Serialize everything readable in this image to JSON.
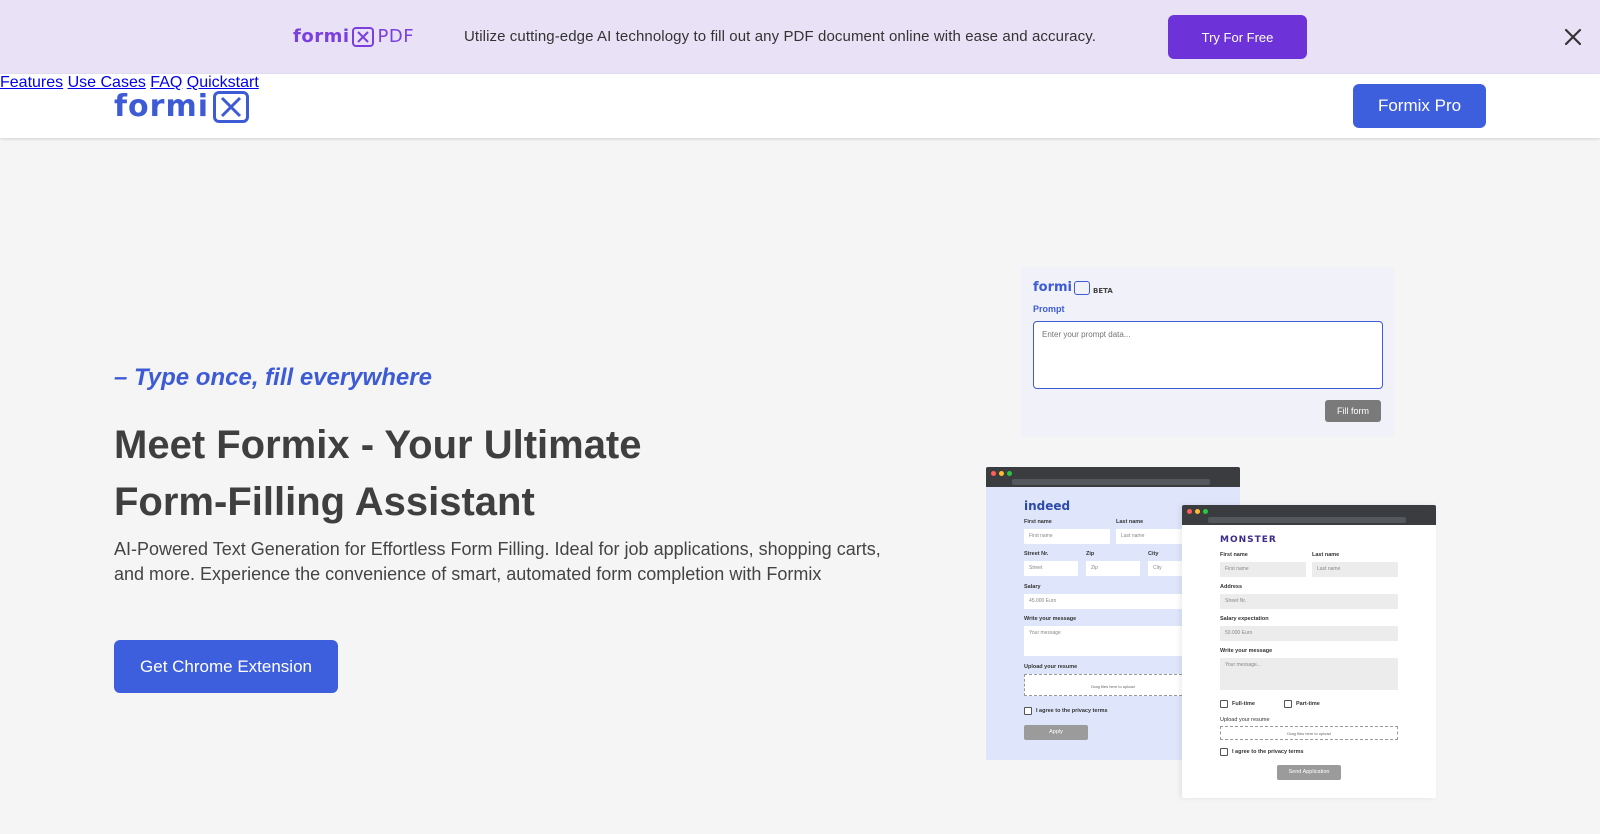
{
  "promo": {
    "logo_text": "formi",
    "logo_suffix": "PDF",
    "message": "Utilize cutting-edge AI technology to fill out any PDF document online with ease and accuracy.",
    "cta_label": "Try For Free"
  },
  "header": {
    "logo_text": "formi",
    "nav": [
      {
        "label": "Features"
      },
      {
        "label": "Use Cases"
      },
      {
        "label": "FAQ"
      },
      {
        "label": "Quickstart"
      }
    ],
    "pro_label": "Formix Pro"
  },
  "hero": {
    "tagline": "– Type once, fill everywhere",
    "headline_line1": "Meet Formix - Your Ultimate",
    "headline_line2": "Form-Filling Assistant",
    "subtitle": "AI-Powered Text Generation for Effortless Form Filling. Ideal for job applications, shopping carts, and more. Experience the convenience of smart, automated form completion with Formix",
    "cta_label": "Get Chrome Extension"
  },
  "extension": {
    "logo_text": "formi",
    "beta": "BETA",
    "prompt_label": "Prompt",
    "prompt_placeholder": "Enter your prompt data...",
    "fill_label": "Fill form"
  },
  "indeed_form": {
    "logo": "indeed",
    "first_name_label": "First name",
    "first_name_ph": "First name",
    "last_name_label": "Last name",
    "last_name_ph": "Last name",
    "street_label": "Street Nr.",
    "street_ph": "Street",
    "zip_label": "Zip",
    "zip_ph": "Zip",
    "city_label": "City",
    "city_ph": "City",
    "salary_label": "Salary",
    "salary_ph": "45.000 Euro",
    "message_label": "Write your message",
    "message_ph": "Your message",
    "resume_label": "Upload your resume",
    "upload_text": "Drag files here to upload",
    "terms_label": "I agree to the privacy terms",
    "apply_label": "Apply"
  },
  "monster_form": {
    "logo": "MONSTER",
    "first_name_label": "First name",
    "first_name_ph": "First name",
    "last_name_label": "Last name",
    "last_name_ph": "Last name",
    "address_label": "Address",
    "address_ph": "Street Nr.",
    "salary_label": "Salary expectation",
    "salary_ph": "50.000 Euro",
    "message_label": "Write your message",
    "message_ph": "Your message...",
    "fulltime_label": "Full-time",
    "parttime_label": "Part-time",
    "resume_label": "Upload your resume",
    "upload_text": "Drag files here to upload",
    "terms_label": "I agree to the privacy terms",
    "send_label": "Send Application"
  },
  "colors": {
    "brand_blue": "#3d5bd4",
    "promo_purple": "#6d33d9",
    "promo_bg": "#e9e2f6"
  }
}
